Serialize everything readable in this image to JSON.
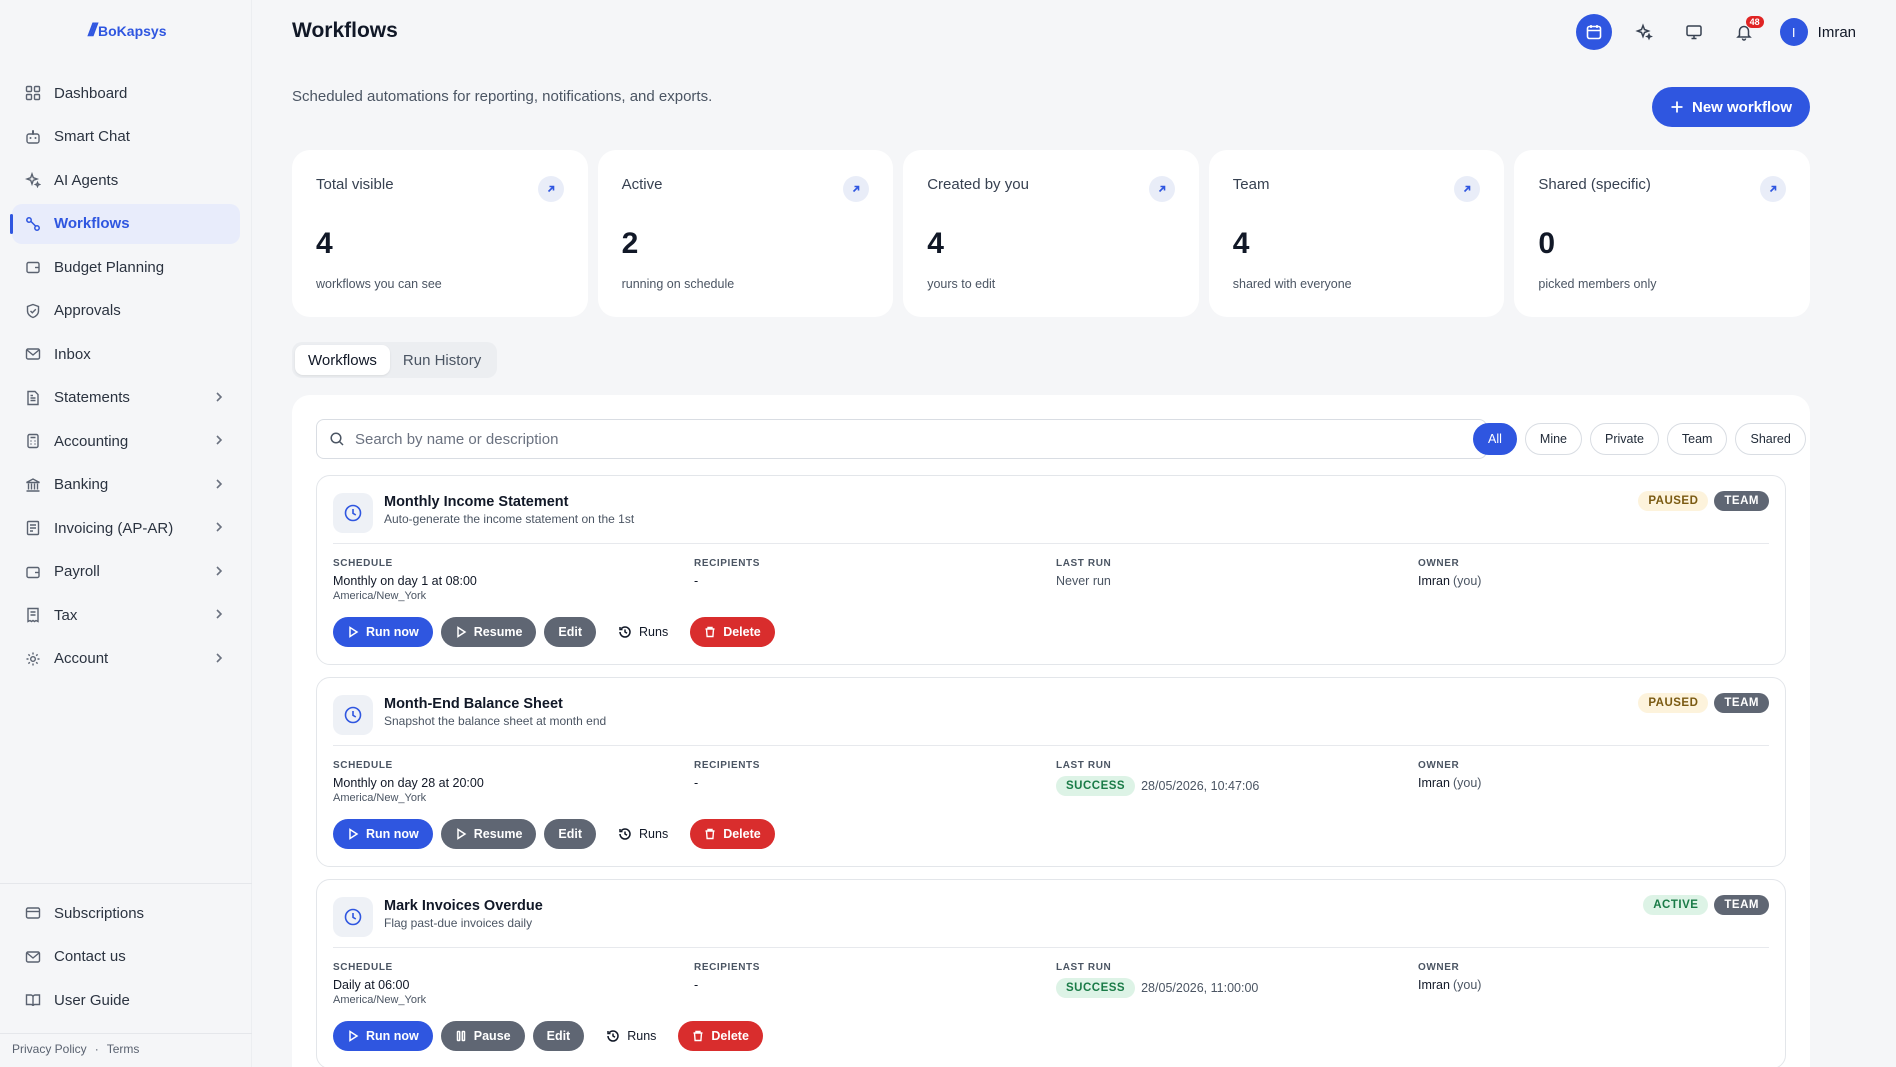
{
  "app": {
    "logo": "BoKapsys"
  },
  "sidebar": {
    "items": [
      {
        "label": "Dashboard",
        "icon": "grid-icon",
        "active": false,
        "chevron": false
      },
      {
        "label": "Smart Chat",
        "icon": "bot-icon",
        "active": false,
        "chevron": false
      },
      {
        "label": "AI Agents",
        "icon": "sparkles-icon",
        "active": false,
        "chevron": false
      },
      {
        "label": "Workflows",
        "icon": "workflow-icon",
        "active": true,
        "chevron": false
      },
      {
        "label": "Budget Planning",
        "icon": "wallet-icon",
        "active": false,
        "chevron": false
      },
      {
        "label": "Approvals",
        "icon": "shield-check-icon",
        "active": false,
        "chevron": false
      },
      {
        "label": "Inbox",
        "icon": "mail-icon",
        "active": false,
        "chevron": false
      },
      {
        "label": "Statements",
        "icon": "document-icon",
        "active": false,
        "chevron": true
      },
      {
        "label": "Accounting",
        "icon": "calculator-icon",
        "active": false,
        "chevron": true
      },
      {
        "label": "Banking",
        "icon": "bank-icon",
        "active": false,
        "chevron": true
      },
      {
        "label": "Invoicing (AP-AR)",
        "icon": "invoice-icon",
        "active": false,
        "chevron": true
      },
      {
        "label": "Payroll",
        "icon": "wallet-icon",
        "active": false,
        "chevron": true
      },
      {
        "label": "Tax",
        "icon": "receipt-icon",
        "active": false,
        "chevron": true
      },
      {
        "label": "Account",
        "icon": "gear-icon",
        "active": false,
        "chevron": true
      }
    ],
    "bottom": [
      {
        "label": "Subscriptions",
        "icon": "card-icon"
      },
      {
        "label": "Contact us",
        "icon": "mail-icon"
      },
      {
        "label": "User Guide",
        "icon": "book-icon"
      }
    ],
    "footer": {
      "privacy": "Privacy Policy",
      "sep": "·",
      "terms": "Terms"
    }
  },
  "header": {
    "title": "Workflows",
    "subtitle": "Scheduled automations for reporting, notifications, and exports.",
    "notifications": "48",
    "user_initial": "I",
    "user_name": "Imran",
    "new_button": "New workflow"
  },
  "stats": [
    {
      "label": "Total visible",
      "value": "4",
      "desc": "workflows you can see"
    },
    {
      "label": "Active",
      "value": "2",
      "desc": "running on schedule"
    },
    {
      "label": "Created by you",
      "value": "4",
      "desc": "yours to edit"
    },
    {
      "label": "Team",
      "value": "4",
      "desc": "shared with everyone"
    },
    {
      "label": "Shared (specific)",
      "value": "0",
      "desc": "picked members only"
    }
  ],
  "tabs": [
    "Workflows",
    "Run History"
  ],
  "search": {
    "placeholder": "Search by name or description"
  },
  "filters": [
    "All",
    "Mine",
    "Private",
    "Team",
    "Shared"
  ],
  "labels": {
    "schedule": "SCHEDULE",
    "recipients": "RECIPIENTS",
    "last_run": "LAST RUN",
    "owner": "OWNER",
    "run_now": "Run now",
    "edit": "Edit",
    "runs": "Runs",
    "delete": "Delete",
    "you": "(you)"
  },
  "workflows": [
    {
      "name": "Monthly Income Statement",
      "desc": "Auto-generate the income statement on the 1st",
      "status": "PAUSED",
      "visibility": "TEAM",
      "schedule": "Monthly on day 1 at 08:00",
      "tz": "America/New_York",
      "recipients": "-",
      "last_run_status": "",
      "last_run_text": "Never run",
      "owner": "Imran",
      "toggle_label": "Resume"
    },
    {
      "name": "Month-End Balance Sheet",
      "desc": "Snapshot the balance sheet at month end",
      "status": "PAUSED",
      "visibility": "TEAM",
      "schedule": "Monthly on day 28 at 20:00",
      "tz": "America/New_York",
      "recipients": "-",
      "last_run_status": "SUCCESS",
      "last_run_text": "28/05/2026, 10:47:06",
      "owner": "Imran",
      "toggle_label": "Resume"
    },
    {
      "name": "Mark Invoices Overdue",
      "desc": "Flag past-due invoices daily",
      "status": "ACTIVE",
      "visibility": "TEAM",
      "schedule": "Daily at 06:00",
      "tz": "America/New_York",
      "recipients": "-",
      "last_run_status": "SUCCESS",
      "last_run_text": "28/05/2026, 11:00:00",
      "owner": "Imran",
      "toggle_label": "Pause"
    }
  ]
}
